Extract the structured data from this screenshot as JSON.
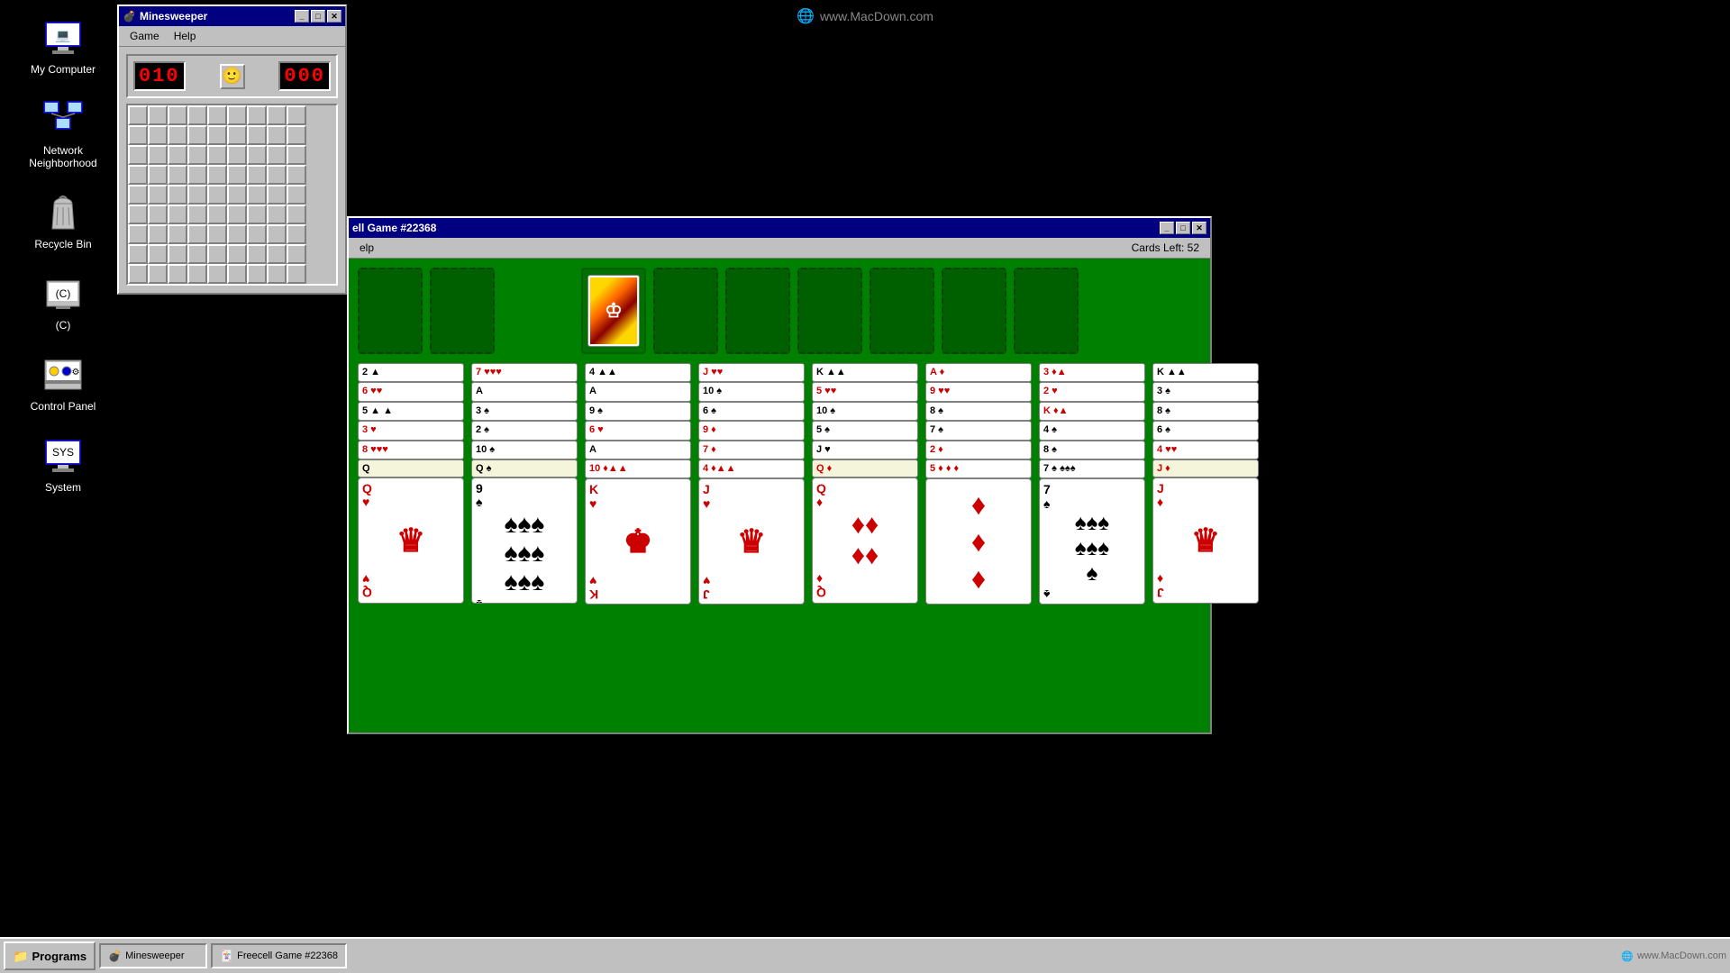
{
  "desktop": {
    "background": "#000000"
  },
  "icons": [
    {
      "id": "my-computer",
      "label": "My Computer",
      "symbol": "🖥"
    },
    {
      "id": "network-neighborhood",
      "label": "Network Neighborhood",
      "symbol": "🖧"
    },
    {
      "id": "recycle-bin",
      "label": "Recycle Bin",
      "symbol": "🗑"
    },
    {
      "id": "c-drive",
      "label": "(C)",
      "symbol": "💾"
    },
    {
      "id": "control-panel",
      "label": "Control Panel",
      "symbol": "🔧"
    },
    {
      "id": "system",
      "label": "System",
      "symbol": "🖥"
    }
  ],
  "watermark": "www.MacDown.com",
  "minesweeper": {
    "title": "Minesweeper",
    "menus": [
      "Game",
      "Help"
    ],
    "counter_left": "010",
    "counter_right": "000",
    "grid_rows": 9,
    "grid_cols": 9
  },
  "solitaire": {
    "title": "ell Game #22368",
    "menus": [
      "elp"
    ],
    "cards_left_label": "Cards Left: 52",
    "columns": [
      {
        "cards": [
          "2♠",
          "6♥♥",
          "5♠",
          "3♥",
          "8♥♥♥",
          "Q"
        ],
        "bottom_rank": "Q",
        "bottom_suit": "♥",
        "color": "red"
      },
      {
        "cards": [
          "7♥♥♥",
          "A",
          "3♠",
          "2♠",
          "10♠",
          "Q♠"
        ],
        "bottom_rank": "9",
        "bottom_suit": "♠",
        "color": "black"
      },
      {
        "cards": [
          "4♠",
          "A",
          "9♠",
          "6♥",
          "A",
          "10♦"
        ],
        "bottom_rank": "K",
        "bottom_suit": "♥",
        "color": "red"
      },
      {
        "cards": [
          "J♥♥",
          "10♠",
          "6♠",
          "9♦",
          "7♦",
          "4♦"
        ],
        "bottom_rank": "J",
        "bottom_suit": "♥",
        "color": "red"
      },
      {
        "cards": [
          "K♠",
          "5♥♥",
          "10♠",
          "5♠",
          "J",
          "Q♦"
        ],
        "bottom_rank": "Q",
        "bottom_suit": "♦",
        "color": "red"
      },
      {
        "cards": [
          "A♦",
          "9♥♥",
          "8♠",
          "7♠",
          "2♦",
          "5♦"
        ],
        "bottom_rank": "♦",
        "bottom_suit": "",
        "color": "red"
      },
      {
        "cards": [
          "3♦",
          "2♥",
          "K♦",
          "4♠",
          "8♠",
          "7♠"
        ],
        "bottom_rank": "7",
        "bottom_suit": "♠",
        "color": "black"
      },
      {
        "cards": [
          "K♠",
          "3♠",
          "8♠",
          "6♠",
          "4♥♥",
          "J♦"
        ],
        "bottom_rank": "J",
        "bottom_suit": "♦",
        "color": "red"
      }
    ]
  },
  "taskbar": {
    "start_label": "Programs",
    "start_icon": "📁"
  }
}
